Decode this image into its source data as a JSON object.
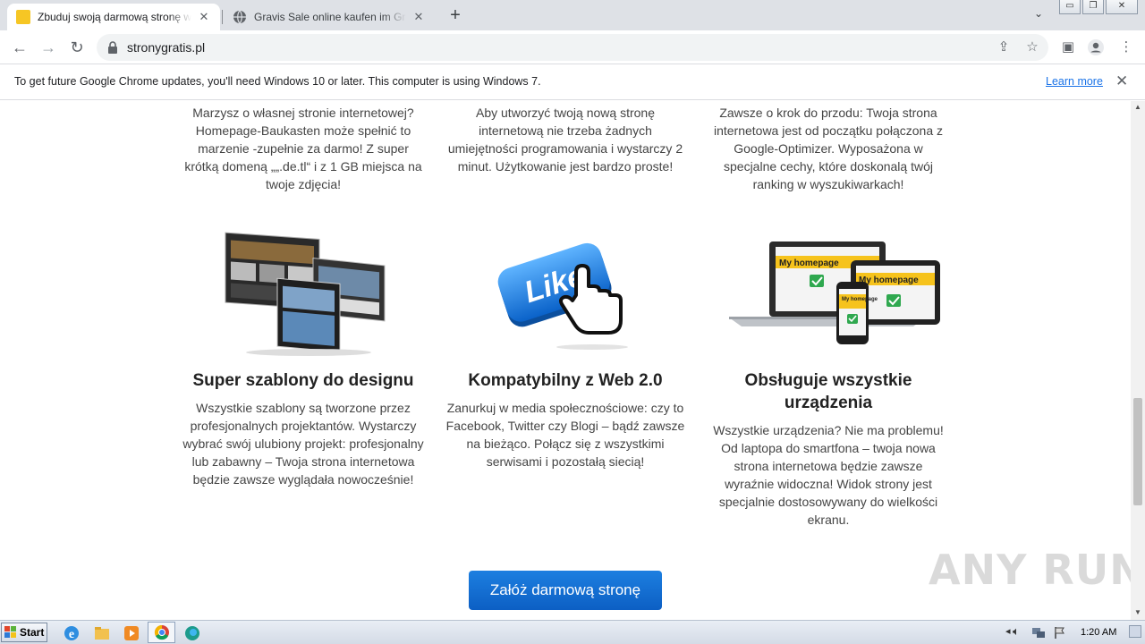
{
  "browser": {
    "tabs": [
      {
        "title": "Zbuduj swoją darmową stronę www",
        "active": true
      },
      {
        "title": "Gravis Sale online kaufen im Gravis S",
        "active": false
      }
    ],
    "new_tab": "+",
    "url": "stronygratis.pl",
    "window_buttons": {
      "minimize": "▭",
      "restore": "❐",
      "close": "✕"
    }
  },
  "infobar": {
    "message": "To get future Google Chrome updates, you'll need Windows 10 or later. This computer is using Windows 7.",
    "link": "Learn more",
    "close": "✕"
  },
  "features_top": [
    {
      "text": "Marzysz o własnej stronie internetowej? Homepage-Baukasten może spełnić to marzenie -zupełnie za darmo! Z super krótką domeną „„.de.tl“ i z 1 GB miejsca na twoje zdjęcia!"
    },
    {
      "text": "Aby utworzyć twoją nową stronę internetową nie trzeba żadnych umiejętności programowania i wystarczy 2 minut. Użytkowanie jest bardzo proste!"
    },
    {
      "text": "Zawsze o krok do przodu: Twoja strona internetowa jest od początku połączona z Google-Optimizer. Wyposażona w specjalne cechy, które doskonalą twój ranking w wyszukiwarkach!"
    }
  ],
  "features": [
    {
      "title": "Super szablony do designu",
      "text": "Wszystkie szablony są tworzone przez profesjonalnych projektantów. Wystarczy wybrać swój ulubiony projekt: profesjonalny lub zabawny – Twoja strona internetowa będzie zawsze wyglądała nowocześnie!"
    },
    {
      "title": "Kompatybilny z Web 2.0",
      "text": "Zanurkuj w media społecznościowe: czy to Facebook, Twitter czy Blogi – bądź zawsze na bieżąco. Połącz się z wszystkimi serwisami i pozostałą siecią!",
      "image_label": "Like"
    },
    {
      "title": "Obsługuje wszystkie urządzenia",
      "text": "Wszystkie urządzenia? Nie ma problemu! Od laptopa do smartfona – twoja nowa strona internetowa będzie zawsze wyraźnie widoczna! Widok strony jest specjalnie dostosowywany do wielkości ekranu.",
      "image_labels": [
        "My homepage",
        "My homepage",
        "My homepage"
      ]
    }
  ],
  "cta": "Załóż darmową stronę",
  "watermark": "ANY RUN",
  "taskbar": {
    "start": "Start",
    "clock": "1:20 AM"
  }
}
